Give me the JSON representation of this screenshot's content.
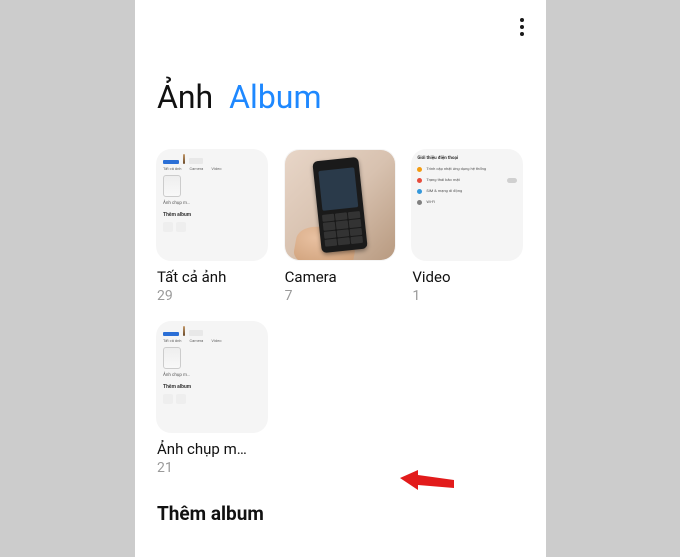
{
  "header": {
    "tab_photos": "Ảnh",
    "tab_album": "Album"
  },
  "albums": [
    {
      "title": "Tất cả ảnh",
      "count": "29"
    },
    {
      "title": "Camera",
      "count": "7"
    },
    {
      "title": "Video",
      "count": "1"
    },
    {
      "title": "Ảnh chụp m…",
      "count": "21"
    }
  ],
  "add_album_label": "Thêm album",
  "thumb1_mini": {
    "labels": [
      "Tất cả ảnh",
      "Camera",
      "Video"
    ],
    "line1": "Ảnh chụp m…",
    "bold": "Thêm album"
  },
  "thumb3_settings": {
    "title": "Giới thiệu điện thoại",
    "rows": [
      {
        "color": "#f39c12",
        "text": "Trình cập nhật ứng dụng hệ thống"
      },
      {
        "color": "#e74c3c",
        "text": "Trạng thái bảo mật"
      },
      {
        "color": "#3498db",
        "text": "SIM & mạng di động"
      }
    ],
    "wifi": "Wi-Fi"
  }
}
